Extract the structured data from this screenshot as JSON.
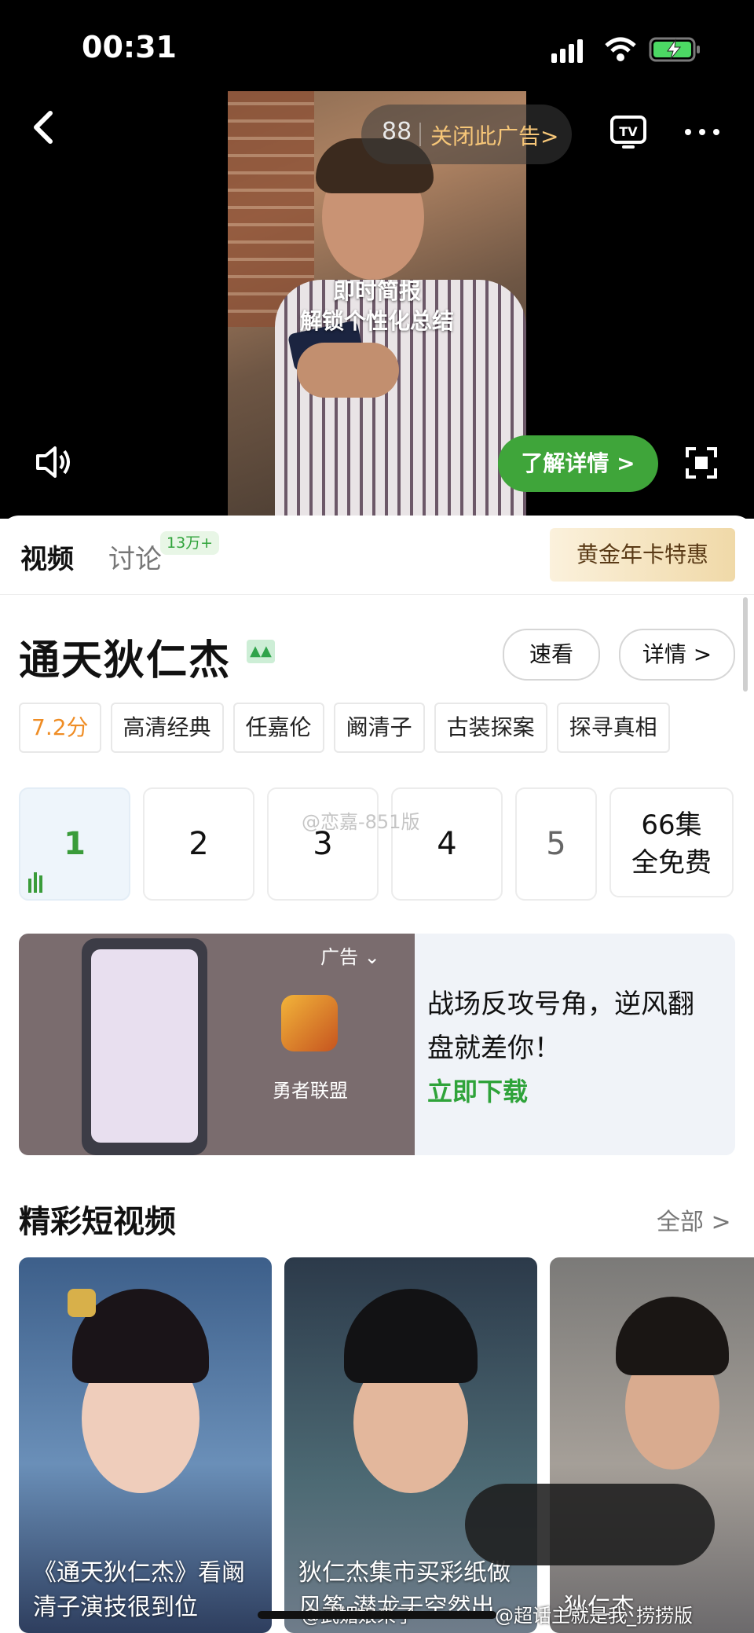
{
  "status_bar": {
    "time": "00:31"
  },
  "player": {
    "ad_countdown": "88",
    "ad_close_label": "关闭此广告>",
    "ad_caption_line1": "即时简报",
    "ad_caption_line2": "解锁个性化总结",
    "learn_more_label": "了解详情 >"
  },
  "tabs": [
    {
      "label": "视频"
    },
    {
      "label": "讨论"
    }
  ],
  "discuss_badge": "13万+",
  "gold_card_label": "黄金年卡特惠",
  "show": {
    "title": "通天狄仁杰",
    "quick_view_label": "速看",
    "details_label": "详情 >",
    "tags": [
      "7.2分",
      "高清经典",
      "任嘉伦",
      "阚清子",
      "古装探案",
      "探寻真相"
    ]
  },
  "episodes": [
    "1",
    "2",
    "3",
    "4",
    "5"
  ],
  "episodes_free_line1": "66集",
  "episodes_free_line2": "全免费",
  "watermark_top": "@恋嘉-851版",
  "ad_banner": {
    "tag_label": "广告",
    "game_name": "勇者联盟",
    "headline": "战场反攻号角，逆风翻盘就差你！",
    "download_label": "立即下载"
  },
  "short_videos": {
    "title": "精彩短视频",
    "all_label": "全部 >",
    "items": [
      {
        "caption": "《通天狄仁杰》看阚清子演技很到位"
      },
      {
        "caption": "狄仁杰集市买彩纸做风筝 潜龙于空然出"
      },
      {
        "caption": "狄仁杰"
      }
    ]
  },
  "watermark_bottom_left": "@武媚娘来了",
  "watermark_bottom_right": "@超话主就是我_捞捞版",
  "colors": {
    "accent_green": "#3fa53a",
    "gold": "#f0d9a8",
    "score_orange": "#ef8d25"
  }
}
